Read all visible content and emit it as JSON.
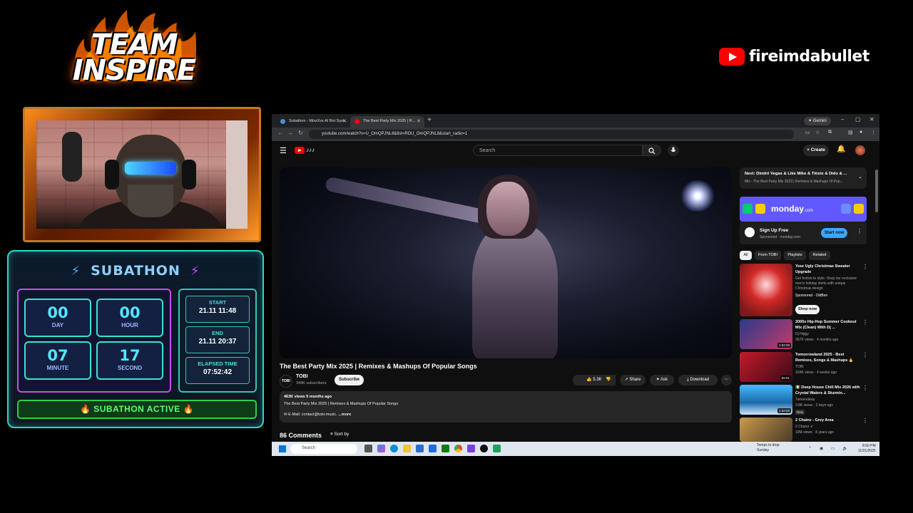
{
  "team_logo": {
    "line1": "TEAM",
    "line2": "INSPIRE"
  },
  "channel": {
    "name": "fireimdabullet"
  },
  "subathon": {
    "title": "SUBATHON",
    "timer": [
      {
        "value": "00",
        "label": "DAY"
      },
      {
        "value": "00",
        "label": "HOUR"
      },
      {
        "value": "07",
        "label": "MINUTE"
      },
      {
        "value": "17",
        "label": "SECOND"
      }
    ],
    "start_label": "START",
    "start_value": "21.11 11:48",
    "end_label": "END",
    "end_value": "21.11 20:37",
    "elapsed_label": "ELAPSED TIME",
    "elapsed_value": "07:52:42",
    "status": "🔥 SUBATHON ACTIVE 🔥"
  },
  "browser": {
    "tabs": [
      {
        "label": "Subathon - MissXxx AI Bot Syst...",
        "favicon_color": "#4a90d9"
      },
      {
        "label": "The Best Party Mix 2025 | R...",
        "favicon_color": "#ff0000"
      }
    ],
    "gemini_label": "Gemini",
    "url": "youtube.com/watch?v=U_OmQPJNL8&list=RDU_OmQPJNL8&start_radio=1"
  },
  "youtube": {
    "search_placeholder": "Search",
    "create_label": "Create",
    "video_title": "The Best Party Mix 2025 | Remixes & Mashups Of Popular Songs",
    "channel_name": "TOBI",
    "subscribers": "349K subscribers",
    "subscribe_label": "Subscribe",
    "like_count": "5.3K",
    "share_label": "Share",
    "ask_label": "Ask",
    "download_label": "Download",
    "desc_stats": "463K views  9 months ago",
    "desc_text": "The Best Party Mix 2025 | Remixes & Mashups Of Popular Songs",
    "desc_email": "E-Mail: contact@tobi-music.",
    "desc_more": "...more",
    "comments_count": "86 Comments",
    "sort_label": "Sort by",
    "next_title": "Next: Dimitri Vegas & Like Mike & Tiësto & Dido & ...",
    "next_sub": "Mix - The Best Party Mix 2023 | Remixes & Mashups Of Pop...",
    "ad": {
      "logo": "monday",
      "logo_suffix": ".com",
      "title": "Sign Up Free",
      "sponsor": "Sponsored · monday.com",
      "cta": "Start now"
    },
    "filters": [
      "All",
      "From TOBI",
      "Playlists",
      "Related"
    ],
    "recommendations": [
      {
        "title": "Your Ugly Christmas Sweater Upgrade",
        "channel": "Get festive in style. Shop our exclusive men's holiday shirts with unique Christmas design",
        "meta": "Sponsored · OldBen",
        "cta": "Shop now",
        "duration": "",
        "thumb": "#7a1a1a"
      },
      {
        "title": "2000s Hip-Hop Summer Cookout Mix (Clean) With Dj ...",
        "channel": "Dj Higgy",
        "meta": "267K views · 4 months ago",
        "duration": "1:02:29",
        "thumb": "#2a3a8a"
      },
      {
        "title": "Tomorrowland 2025 - Best Remixes, Songs & Mashups 🔥",
        "channel": "TOBI",
        "meta": "104K views · 4 weeks ago",
        "duration": "55:01",
        "thumb": "#8a1a2a"
      },
      {
        "title": "🇮🇹 Deep House Chill Mix 2026 with Crystal Waters & Stunnin...",
        "channel": "7sevendeep",
        "meta": "3.8K views · 2 days ago",
        "badge": "New",
        "duration": "1:32:00",
        "thumb": "#1a6aa8"
      },
      {
        "title": "2 Chainz - Grey Area",
        "channel": "2 Chainz ✔",
        "meta": "10M views · 4 years ago",
        "duration": "",
        "thumb": "#8a6a2a"
      }
    ]
  },
  "taskbar": {
    "search_placeholder": "Search",
    "weather_line1": "Temps to drop",
    "weather_line2": "Sunday",
    "time": "8:50 PM",
    "date": "11/21/2025"
  }
}
